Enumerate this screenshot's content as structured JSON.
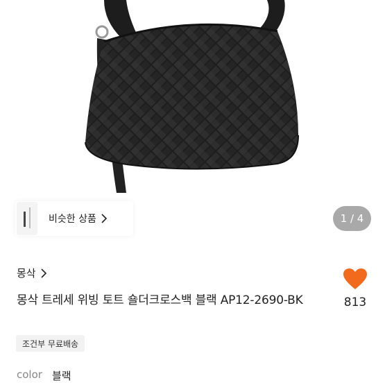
{
  "product_image": {
    "alt": "black woven shoulder bag"
  },
  "similar": {
    "label": "비슷한 상품"
  },
  "gallery": {
    "counter": "1 / 4"
  },
  "shop": {
    "name": "몽삭"
  },
  "product": {
    "title": "몽삭 트레세 위빙 토트 숄더크로스백 블랙 AP12-2690-BK"
  },
  "like": {
    "count": "813",
    "color": "#f26a1b"
  },
  "badge": {
    "label": "조건부 무료배송"
  },
  "option": {
    "key": "color",
    "value": "블랙"
  }
}
